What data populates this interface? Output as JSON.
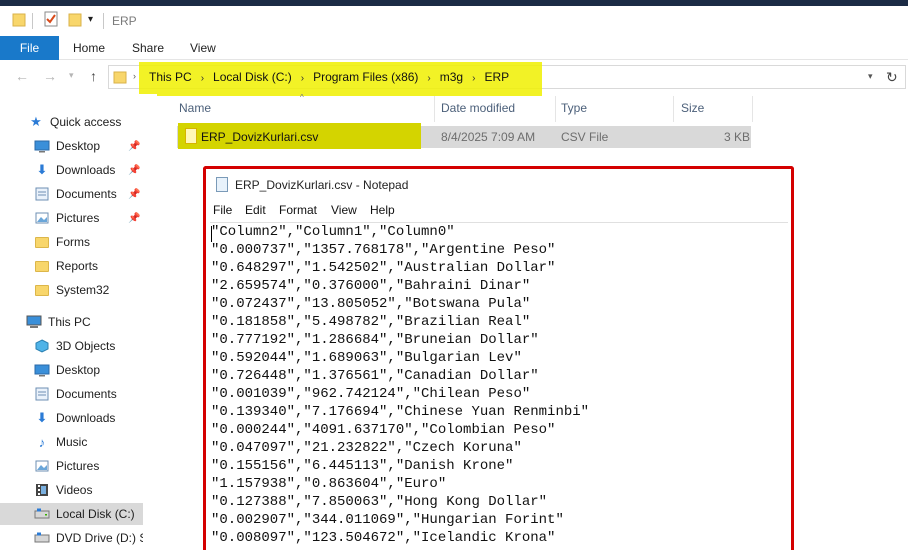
{
  "window": {
    "title": "ERP"
  },
  "ribbon": {
    "file": "File",
    "tabs": [
      "Home",
      "Share",
      "View"
    ]
  },
  "address": {
    "crumbs": [
      "This PC",
      "Local Disk (C:)",
      "Program Files (x86)",
      "m3g",
      "ERP"
    ]
  },
  "sidebar": {
    "items": [
      {
        "label": "Quick access",
        "icon": "star-icon",
        "pinned": false
      },
      {
        "label": "Desktop",
        "icon": "desktop-icon",
        "pinned": true
      },
      {
        "label": "Downloads",
        "icon": "download-icon",
        "pinned": true
      },
      {
        "label": "Documents",
        "icon": "documents-icon",
        "pinned": true
      },
      {
        "label": "Pictures",
        "icon": "pictures-icon",
        "pinned": true
      },
      {
        "label": "Forms",
        "icon": "folder-icon",
        "pinned": false
      },
      {
        "label": "Reports",
        "icon": "folder-icon",
        "pinned": false
      },
      {
        "label": "System32",
        "icon": "folder-icon",
        "pinned": false
      },
      {
        "label": "This PC",
        "icon": "computer-icon",
        "pinned": false
      },
      {
        "label": "3D Objects",
        "icon": "cube-icon",
        "pinned": false
      },
      {
        "label": "Desktop",
        "icon": "desktop-icon",
        "pinned": false
      },
      {
        "label": "Documents",
        "icon": "documents-icon",
        "pinned": false
      },
      {
        "label": "Downloads",
        "icon": "download-icon",
        "pinned": false
      },
      {
        "label": "Music",
        "icon": "music-icon",
        "pinned": false
      },
      {
        "label": "Pictures",
        "icon": "pictures-icon",
        "pinned": false
      },
      {
        "label": "Videos",
        "icon": "videos-icon",
        "pinned": false
      },
      {
        "label": "Local Disk (C:)",
        "icon": "drive-icon",
        "pinned": false,
        "selected": true
      },
      {
        "label": "DVD Drive (D:) SS",
        "icon": "dvd-icon",
        "pinned": false
      }
    ]
  },
  "filelist": {
    "columns": {
      "name": "Name",
      "date": "Date modified",
      "type": "Type",
      "size": "Size"
    },
    "files": [
      {
        "name": "ERP_DovizKurlari.csv",
        "date": "8/4/2025 7:09 AM",
        "type": "CSV File",
        "size": "3 KB"
      }
    ]
  },
  "notepad": {
    "title": "ERP_DovizKurlari.csv - Notepad",
    "menu": [
      "File",
      "Edit",
      "Format",
      "View",
      "Help"
    ],
    "lines": [
      "\"Column2\",\"Column1\",\"Column0\"",
      "\"0.000737\",\"1357.768178\",\"Argentine Peso\"",
      "\"0.648297\",\"1.542502\",\"Australian Dollar\"",
      "\"2.659574\",\"0.376000\",\"Bahraini Dinar\"",
      "\"0.072437\",\"13.805052\",\"Botswana Pula\"",
      "\"0.181858\",\"5.498782\",\"Brazilian Real\"",
      "\"0.777192\",\"1.286684\",\"Bruneian Dollar\"",
      "\"0.592044\",\"1.689063\",\"Bulgarian Lev\"",
      "\"0.726448\",\"1.376561\",\"Canadian Dollar\"",
      "\"0.001039\",\"962.742124\",\"Chilean Peso\"",
      "\"0.139340\",\"7.176694\",\"Chinese Yuan Renminbi\"",
      "\"0.000244\",\"4091.637170\",\"Colombian Peso\"",
      "\"0.047097\",\"21.232822\",\"Czech Koruna\"",
      "\"0.155156\",\"6.445113\",\"Danish Krone\"",
      "\"1.157938\",\"0.863604\",\"Euro\"",
      "\"0.127388\",\"7.850063\",\"Hong Kong Dollar\"",
      "\"0.002907\",\"344.011069\",\"Hungarian Forint\"",
      "\"0.008097\",\"123.504672\",\"Icelandic Krona\""
    ]
  }
}
